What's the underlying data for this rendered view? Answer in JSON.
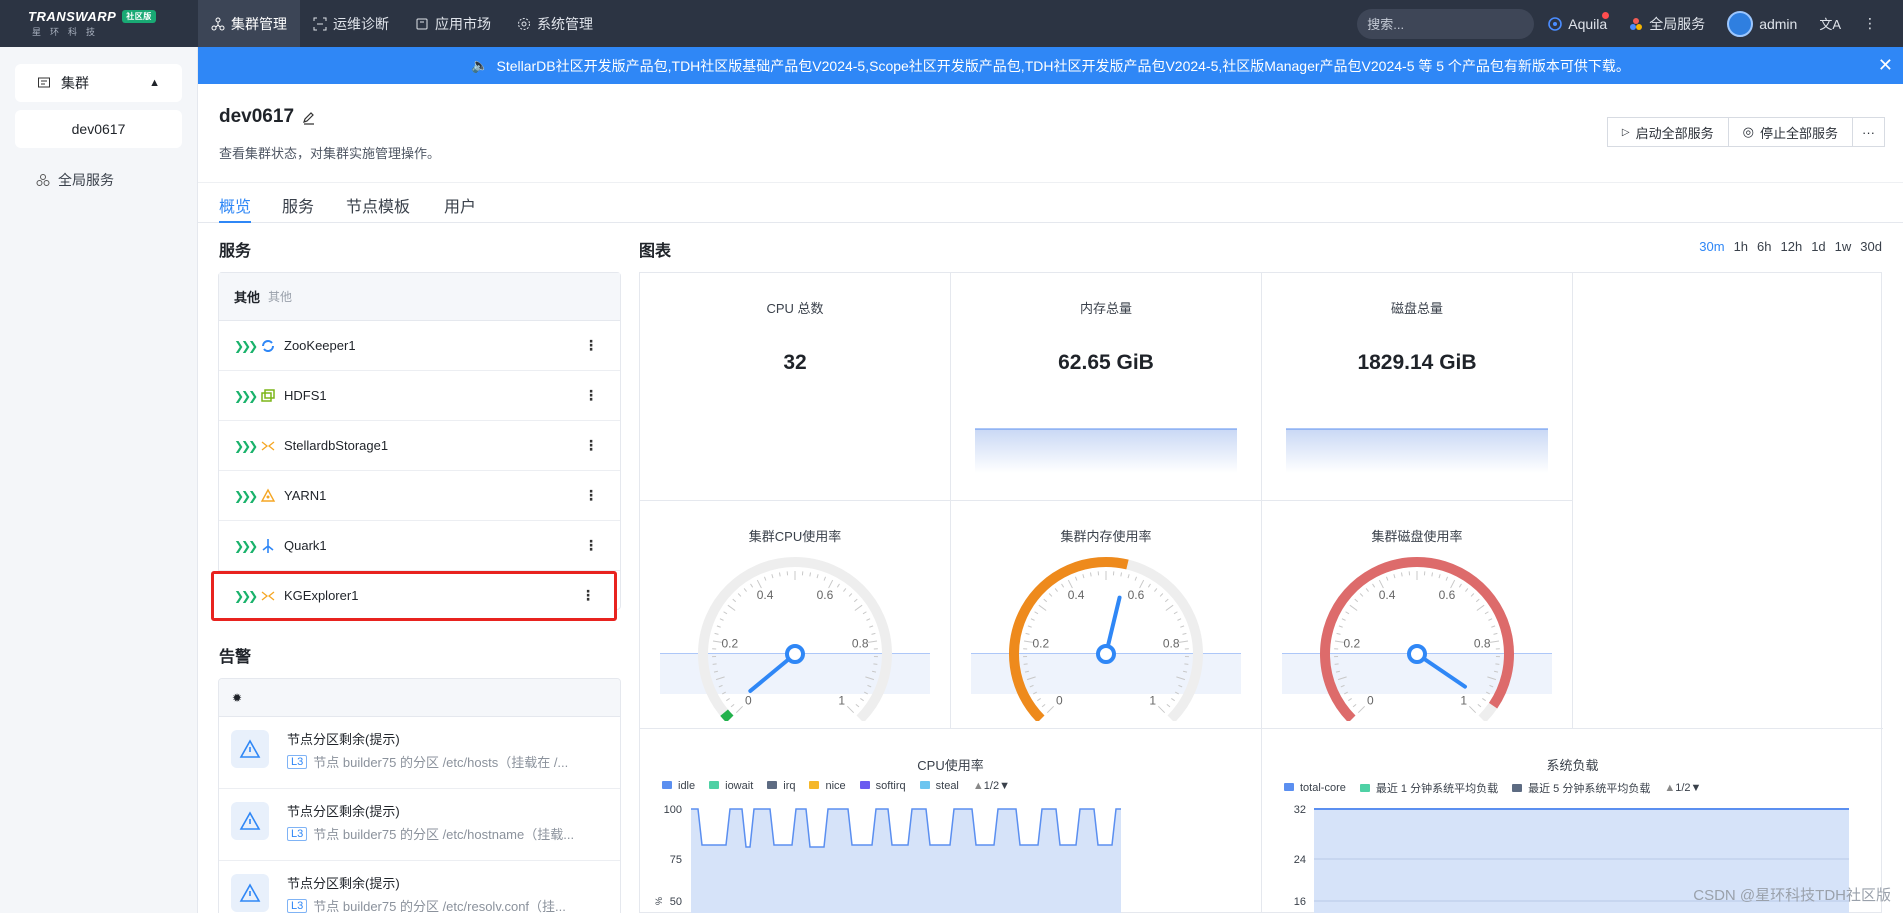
{
  "topbar": {
    "logo_text": "TRANSWARP",
    "logo_badge": "社区版",
    "logo_sub": "星环科技",
    "nav": [
      {
        "label": "集群管理",
        "active": true
      },
      {
        "label": "运维诊断"
      },
      {
        "label": "应用市场"
      },
      {
        "label": "系统管理"
      }
    ],
    "search_placeholder": "搜索...",
    "aquila": "Aquila",
    "global_services": "全局服务",
    "user": "admin"
  },
  "sidebar": {
    "group": "集群",
    "cluster": "dev0617",
    "global": "全局服务"
  },
  "banner": "StellarDB社区开发版产品包,TDH社区版基础产品包V2024-5,Scope社区开发版产品包,TDH社区开发版产品包V2024-5,社区版Manager产品包V2024-5 等 5 个产品包有新版本可供下载。",
  "header": {
    "title": "dev0617",
    "desc": "查看集群状态，对集群实施管理操作。",
    "start_all": "启动全部服务",
    "stop_all": "停止全部服务"
  },
  "tabs": [
    "概览",
    "服务",
    "节点模板",
    "用户"
  ],
  "services": {
    "title": "服务",
    "group": "其他",
    "group_sub": "其他",
    "items": [
      "ZooKeeper1",
      "HDFS1",
      "StellardbStorage1",
      "YARN1",
      "Quark1",
      "KGExplorer1"
    ]
  },
  "alerts": {
    "title": "告警",
    "items": [
      {
        "title": "节点分区剩余(提示)",
        "level": "L3",
        "desc": "节点 builder75 的分区 /etc/hosts（挂载在 /..."
      },
      {
        "title": "节点分区剩余(提示)",
        "level": "L3",
        "desc": "节点 builder75 的分区 /etc/hostname（挂载..."
      },
      {
        "title": "节点分区剩余(提示)",
        "level": "L3",
        "desc": "节点 builder75 的分区 /etc/resolv.conf（挂..."
      }
    ]
  },
  "charts": {
    "title": "图表",
    "ranges": [
      "30m",
      "1h",
      "6h",
      "12h",
      "1d",
      "1w",
      "30d"
    ],
    "stats": [
      {
        "label": "CPU 总数",
        "value": "32"
      },
      {
        "label": "内存总量",
        "value": "62.65 GiB"
      },
      {
        "label": "磁盘总量",
        "value": "1829.14 GiB"
      }
    ],
    "gauges": [
      {
        "label": "集群CPU使用率",
        "value": 0.02,
        "color": "#22b14c"
      },
      {
        "label": "集群内存使用率",
        "value": 0.55,
        "color": "#ee8a1c"
      },
      {
        "label": "集群磁盘使用率",
        "value": 0.96,
        "color": "#dd6b6b"
      }
    ],
    "gauge_ticks": [
      "0",
      "0.2",
      "0.4",
      "0.6",
      "0.8",
      "1"
    ],
    "cpu_chart": {
      "title": "CPU使用率",
      "legend": [
        "idle",
        "iowait",
        "irq",
        "nice",
        "softirq",
        "steal"
      ],
      "page": "1/2",
      "yticks": [
        "100",
        "75",
        "50"
      ],
      "unit": "%"
    },
    "load_chart": {
      "title": "系统负载",
      "legend": [
        "total-core",
        "最近 1 分钟系统平均负载",
        "最近 5 分钟系统平均负载"
      ],
      "page": "1/2",
      "yticks": [
        "32",
        "24",
        "16"
      ]
    }
  },
  "watermark": "CSDN @星环科技TDH社区版"
}
